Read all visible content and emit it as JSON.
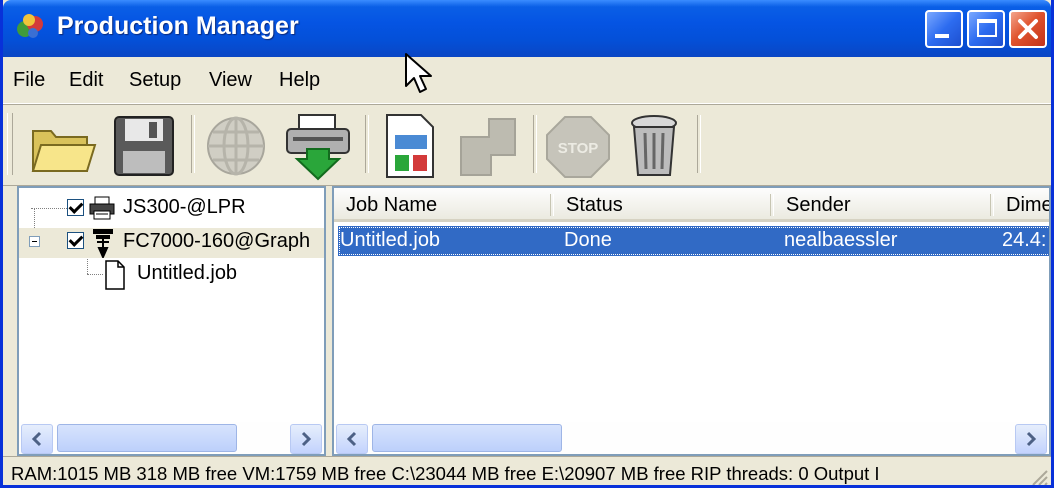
{
  "window": {
    "title": "Production Manager"
  },
  "menu": [
    "File",
    "Edit",
    "Setup",
    "View",
    "Help"
  ],
  "toolbar": {
    "stop_label": "STOP",
    "buttons": [
      "open-folder",
      "save-disk",
      "globe-network",
      "print-download",
      "job-layout",
      "puzzle-disabled",
      "stop-sign",
      "trash-can"
    ]
  },
  "tree": {
    "items": [
      {
        "label": "JS300-@LPR",
        "checked": true,
        "icon": "printer-icon"
      },
      {
        "label": "FC7000-160@Graph",
        "checked": true,
        "icon": "plotter-icon",
        "expanded": true
      },
      {
        "label": "Untitled.job",
        "icon": "document-icon"
      }
    ]
  },
  "list": {
    "columns": [
      "Job Name",
      "Status",
      "Sender",
      "Dime"
    ],
    "rows": [
      {
        "job_name": "Untitled.job",
        "status": "Done",
        "sender": "nealbaessler",
        "dime": "24.4:",
        "selected": true
      }
    ]
  },
  "status": {
    "text": "RAM:1015 MB 318 MB free VM:1759 MB free C:\\23044 MB free E:\\20907 MB free RIP threads: 0 Output I"
  },
  "colors": {
    "title_bar": "#0554e3",
    "selection": "#316ac5",
    "close_button": "#e0542e",
    "window_bg": "#ece9d8"
  }
}
